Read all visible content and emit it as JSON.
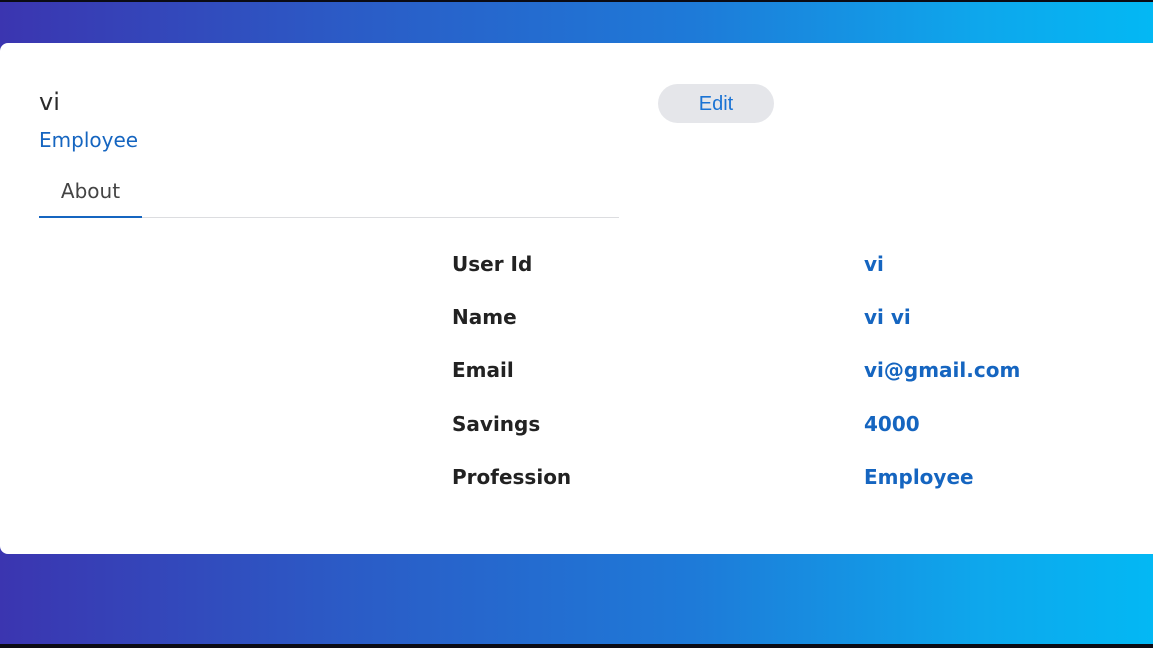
{
  "profile": {
    "name": "vi",
    "role": "Employee"
  },
  "actions": {
    "edit_label": "Edit"
  },
  "tabs": [
    {
      "label": "About",
      "active": true
    }
  ],
  "details": [
    {
      "label": "User Id",
      "value": "vi"
    },
    {
      "label": "Name",
      "value": "vi vi"
    },
    {
      "label": "Email",
      "value": "vi@gmail.com"
    },
    {
      "label": "Savings",
      "value": "4000"
    },
    {
      "label": "Profession",
      "value": "Employee"
    }
  ],
  "colors": {
    "accent": "#1565c0",
    "gradient_start": "#3b35b0",
    "gradient_end": "#03b8f4",
    "button_bg": "#e5e6ea"
  }
}
